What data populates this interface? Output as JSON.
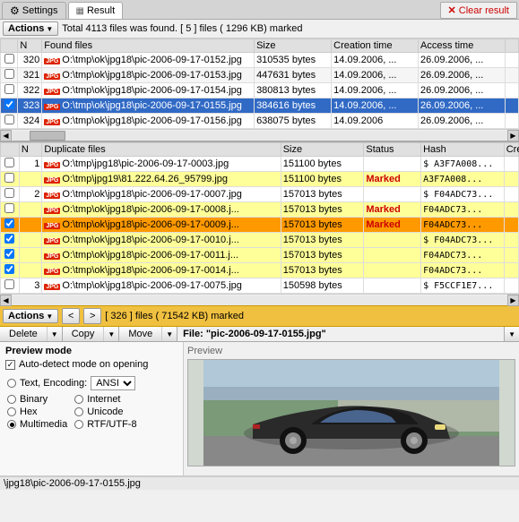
{
  "tabs": {
    "settings_label": "Settings",
    "result_label": "Result",
    "clear_btn": "Clear result"
  },
  "top_section": {
    "actions_label": "Actions",
    "status": "Total 4113 files was found. [ 5 ] files ( 1296 KB) marked",
    "columns": [
      "N",
      "Found files",
      "Size",
      "Creation time",
      "Access time",
      ""
    ],
    "rows": [
      {
        "num": "320",
        "icon": "JPG",
        "path": "O:\\tmp\\ok\\jpg18\\pic-2006-09-17-0152.jpg",
        "size": "310535 bytes",
        "created": "14.09.2006, ...",
        "access": "26.09.2006, ...",
        "selected": false
      },
      {
        "num": "321",
        "icon": "JPG",
        "path": "O:\\tmp\\ok\\jpg18\\pic-2006-09-17-0153.jpg",
        "size": "447631 bytes",
        "created": "14.09.2006, ...",
        "access": "26.09.2006, ...",
        "selected": false
      },
      {
        "num": "322",
        "icon": "JPG",
        "path": "O:\\tmp\\ok\\jpg18\\pic-2006-09-17-0154.jpg",
        "size": "380813 bytes",
        "created": "14.09.2006, ...",
        "access": "26.09.2006, ...",
        "selected": false
      },
      {
        "num": "323",
        "icon": "JPG",
        "path": "O:\\tmp\\ok\\jpg18\\pic-2006-09-17-0155.jpg",
        "size": "384616 bytes",
        "created": "14.09.2006, ...",
        "access": "26.09.2006, ...",
        "selected": true
      },
      {
        "num": "324",
        "icon": "JPG",
        "path": "O:\\tmp\\ok\\jpg18\\pic-2006-09-17-0156.jpg",
        "size": "638075 bytes",
        "created": "14.09.2006",
        "access": "26.09.2006, ...",
        "selected": false
      }
    ]
  },
  "dup_section": {
    "columns": [
      "N",
      "Duplicate files",
      "Size",
      "Status",
      "Hash",
      "Cre"
    ],
    "rows": [
      {
        "num": "1",
        "icon": "JPG",
        "path": "O:\\tmp\\jpg18\\pic-2006-09-17-0003.jpg",
        "size": "151100 bytes",
        "status": "",
        "hash": "$ A3F7A008...",
        "type": "normal",
        "checked": false
      },
      {
        "num": "",
        "icon": "JPG",
        "path": "O:\\tmp\\jpg19\\81.222.64.26_95799.jpg",
        "size": "151100 bytes",
        "status": "Marked",
        "hash": "A3F7A008...",
        "type": "yellow",
        "checked": false
      },
      {
        "num": "2",
        "icon": "JPG",
        "path": "O:\\tmp\\ok\\jpg18\\pic-2006-09-17-0007.jpg",
        "size": "157013 bytes",
        "status": "",
        "hash": "$ F04ADC73...",
        "type": "normal",
        "checked": false
      },
      {
        "num": "",
        "icon": "JPG",
        "path": "O:\\tmp\\ok\\jpg18\\pic-2006-09-17-0008.j...",
        "size": "157013 bytes",
        "status": "Marked",
        "hash": "F04ADC73...",
        "type": "yellow",
        "checked": false
      },
      {
        "num": "",
        "icon": "JPG",
        "path": "O:\\tmp\\ok\\jpg18\\pic-2006-09-17-0009.j...",
        "size": "157013 bytes",
        "status": "Marked",
        "hash": "F04ADC73...",
        "type": "orange",
        "checked": true
      },
      {
        "num": "",
        "icon": "JPG",
        "path": "O:\\tmp\\ok\\jpg18\\pic-2006-09-17-0010.j...",
        "size": "157013 bytes",
        "status": "",
        "hash": "$ F04ADC73...",
        "type": "yellow",
        "checked": true
      },
      {
        "num": "",
        "icon": "JPG",
        "path": "O:\\tmp\\ok\\jpg18\\pic-2006-09-17-0011.j...",
        "size": "157013 bytes",
        "status": "",
        "hash": "F04ADC73...",
        "type": "yellow",
        "checked": true
      },
      {
        "num": "",
        "icon": "JPG",
        "path": "O:\\tmp\\ok\\jpg18\\pic-2006-09-17-0014.j...",
        "size": "157013 bytes",
        "status": "",
        "hash": "F04ADC73...",
        "type": "yellow",
        "checked": true
      },
      {
        "num": "3",
        "icon": "JPG",
        "path": "O:\\tmp\\ok\\jpg18\\pic-2006-09-17-0075.jpg",
        "size": "150598 bytes",
        "status": "",
        "hash": "$ F5CCF1E7...",
        "type": "normal",
        "checked": false
      }
    ]
  },
  "bottom_bar": {
    "actions_label": "Actions",
    "prev_btn": "<",
    "next_btn": ">",
    "marked_text": "[ 326 ] files ( 71542 KB) marked"
  },
  "tool_bar": {
    "delete_label": "Delete",
    "copy_label": "Copy",
    "move_label": "Move",
    "file_label": "File: \"pic-2006-09-17-0155.jpg\""
  },
  "preview_mode": {
    "title": "Preview mode",
    "auto_detect": "Auto-detect mode on opening",
    "text_label": "Text, Encoding:",
    "encoding_val": "ANSI",
    "binary_label": "Binary",
    "internet_label": "Internet",
    "hex_label": "Hex",
    "unicode_label": "Unicode",
    "multimedia_label": "Multimedia",
    "rtf_label": "RTF/UTF-8",
    "preview_title": "Preview"
  },
  "status_bar": {
    "path": "\\jpg18\\pic-2006-09-17-0155.jpg"
  },
  "colors": {
    "selected_row_bg": "#316ac5",
    "yellow_row_bg": "#ffff99",
    "orange_row_bg": "#ffcc66",
    "marked_row_bg": "#ff9900",
    "bottom_bar_bg": "#f0c040",
    "tab_active_bg": "#ffffff"
  }
}
